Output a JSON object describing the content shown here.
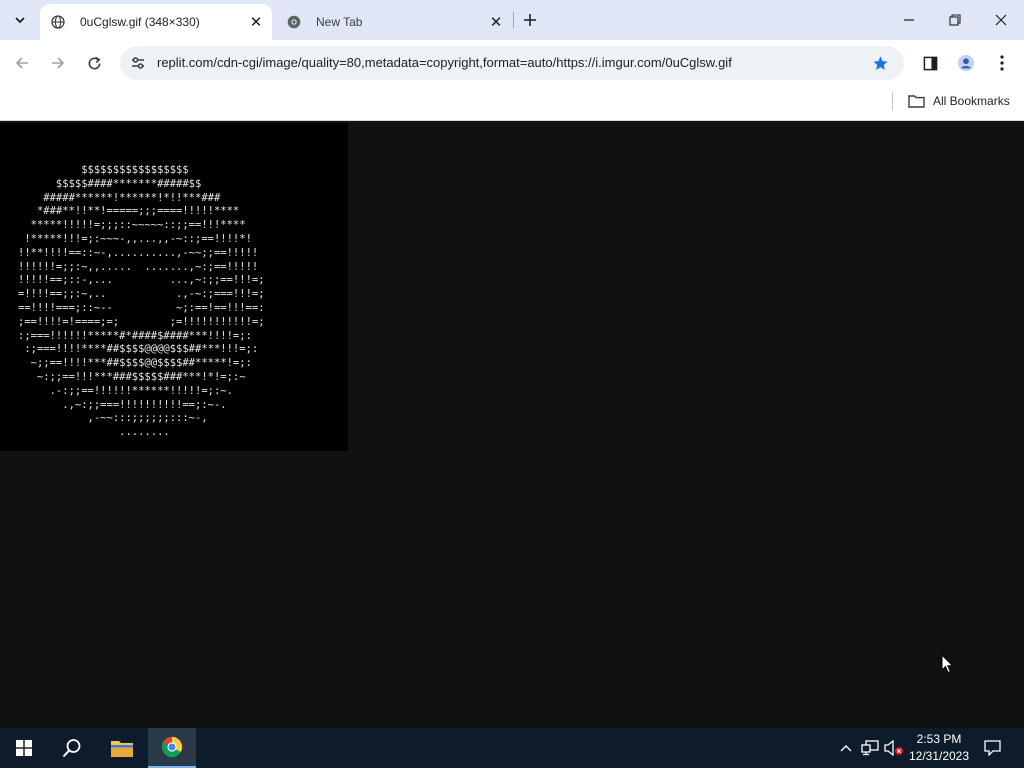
{
  "browser": {
    "tabs": [
      {
        "title": "0uCglsw.gif (348×330)",
        "active": true
      },
      {
        "title": "New Tab",
        "active": false
      }
    ],
    "url": "replit.com/cdn-cgi/image/quality=80,metadata=copyright,format=auto/https://i.imgur.com/0uCglsw.gif",
    "bookmarks": {
      "all_label": "All Bookmarks"
    },
    "accent": "#1a73e8"
  },
  "page": {
    "background": "#111111",
    "image": {
      "ascii_art": "          $$$$$$$$$$$$$$$$$\n      $$$$$####*******#####$$\n    #####******!******!*!!***###\n   *###**!!**!=====;;;====!!!!!****\n  *****!!!!!=;;;::~~~~~::;;==!!!****\n !*****!!!=;:~~~-,,...,,-~::;==!!!!*!\n!!**!!!!==::~-,..........,-~~;;==!!!!!\n!!!!!!=;;:~,,.....  .......,~:;==!!!!!\n!!!!!==;::-,...         ...,~:;;==!!!=;\n=!!!!==;;:~,..           .,-~:;===!!!=;\n==!!!!===;::~--          ~;:==!==!!!==:\n;==!!!!=!====;=;        ;=!!!!!!!!!!!=;\n:;===!!!!!!*****#*####$####***!!!!=;:\n :;===!!!!****##$$$$@@@@$$$##***!!!=;:\n  ~;;==!!!!***##$$$$@@$$$$##*****!=;:\n   ~:;;==!!!***###$$$$$###***!*!=;:~\n     .-:;;==!!!!!!******!!!!!=;:~.\n       .,~:;;===!!!!!!!!!!==;:~-.\n           ,-~~:::;;;;;;:::~-,\n                ........"
    }
  },
  "taskbar": {
    "time": "2:53 PM",
    "date": "12/31/2023"
  }
}
